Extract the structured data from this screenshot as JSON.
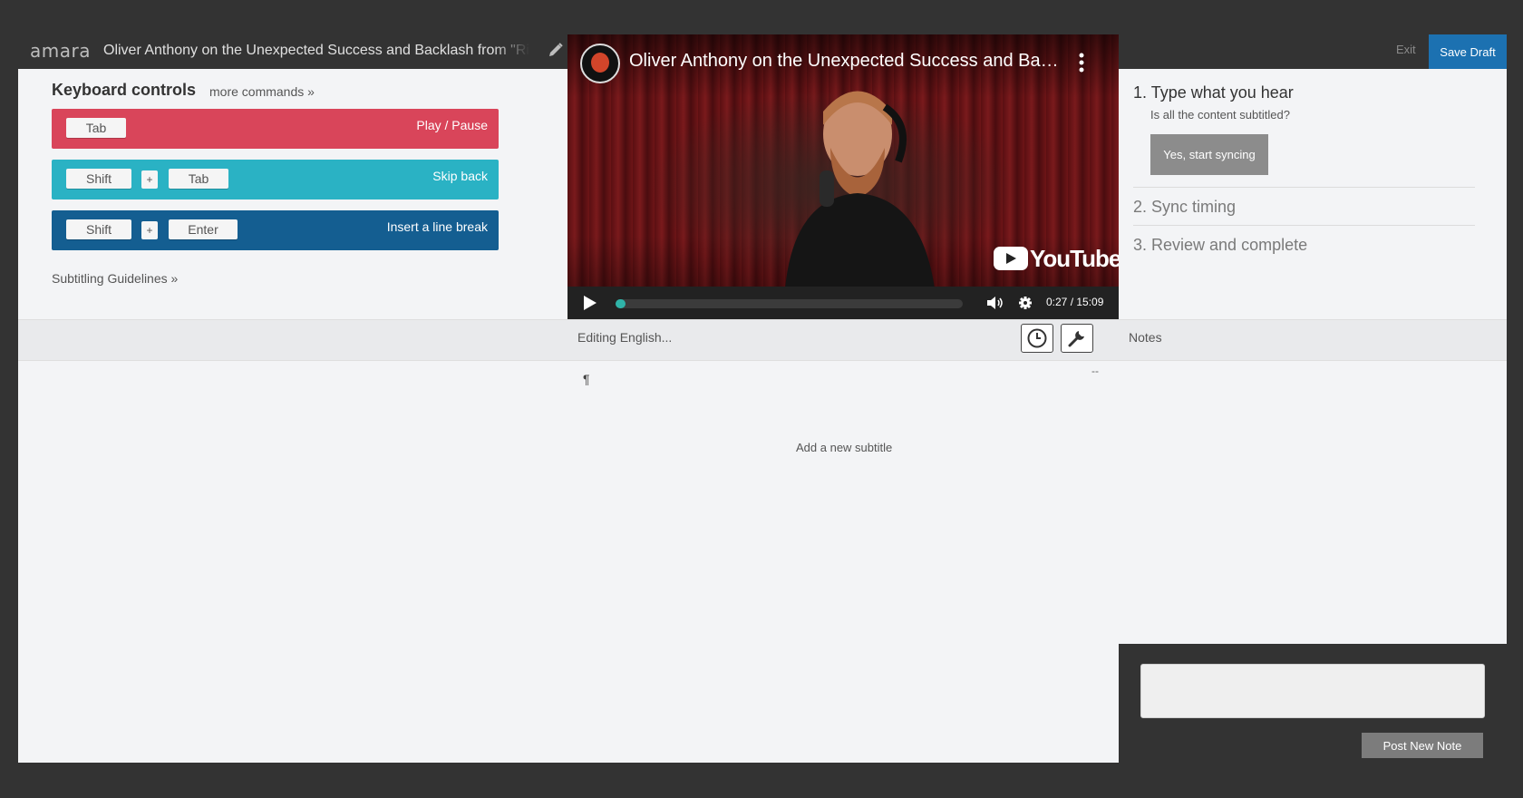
{
  "app": {
    "logo": "amara",
    "title": "Oliver Anthony on the Unexpected Success and Backlash from \"Rich Men North of Richmond\"",
    "exit_label": "Exit",
    "save_draft_label": "Save Draft"
  },
  "keyboard": {
    "title": "Keyboard controls",
    "more_commands": "more commands »",
    "rows": [
      {
        "keys": [
          "Tab"
        ],
        "action": "Play / Pause"
      },
      {
        "keys": [
          "Shift",
          "+",
          "Tab"
        ],
        "action": "Skip back"
      },
      {
        "keys": [
          "Shift",
          "+",
          "Enter"
        ],
        "action": "Insert a line break"
      }
    ],
    "guidelines_link": "Subtitling Guidelines »"
  },
  "video": {
    "title": "Oliver Anthony on the Unexpected Success and Back...",
    "brand": "YouTube",
    "time": "0:27 / 15:09",
    "progress_fraction": 0.03
  },
  "editor": {
    "editing_label": "Editing English...",
    "pilcrow": "¶",
    "dash": "--",
    "add_subtitle": "Add a new subtitle"
  },
  "notes": {
    "label": "Notes",
    "post_label": "Post New Note"
  },
  "steps": {
    "step1": "1. Type what you hear",
    "step1_sub": "Is all the content subtitled?",
    "yes_button": "Yes, start syncing",
    "step2": "2. Sync timing",
    "step3": "3. Review and complete"
  },
  "colors": {
    "play_pause_row": "#d9455a",
    "skip_back_row": "#2ab2c4",
    "line_break_row": "#145e91",
    "save_draft": "#1c71b1",
    "progress": "#2fb3a8"
  }
}
